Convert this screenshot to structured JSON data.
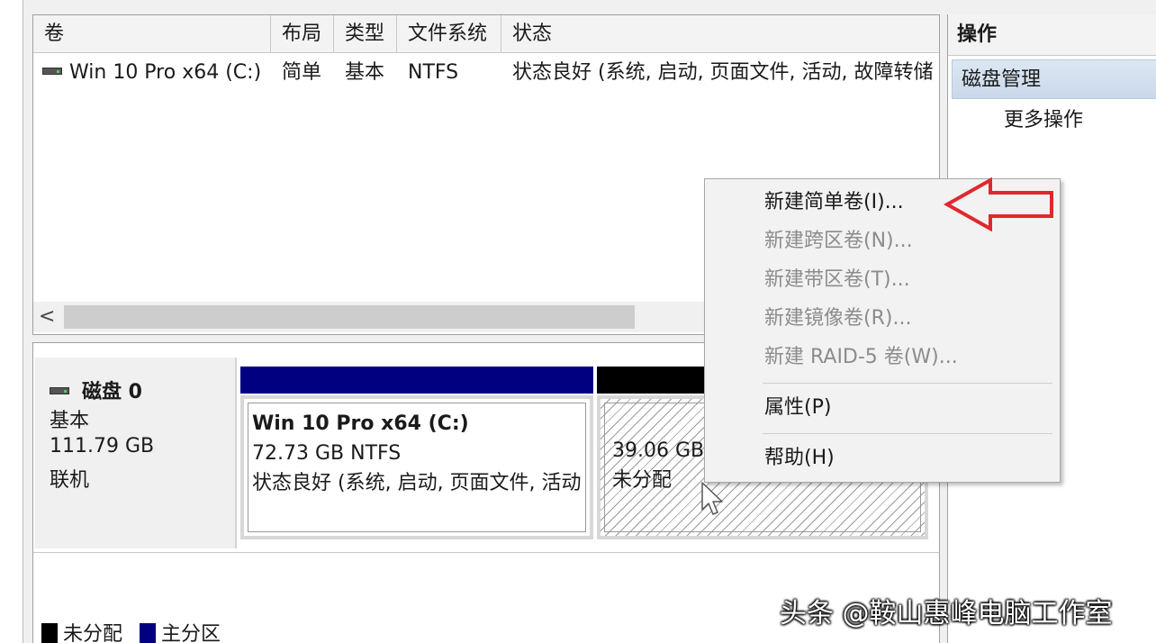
{
  "volume_list": {
    "columns": [
      "卷",
      "布局",
      "类型",
      "文件系统",
      "状态"
    ],
    "rows": [
      {
        "volume": "Win 10 Pro x64 (C:)",
        "layout": "简单",
        "type": "基本",
        "filesystem": "NTFS",
        "status": "状态良好 (系统, 启动, 页面文件, 活动, 故障转储"
      }
    ],
    "scroll_left_arrow": "<"
  },
  "disk": {
    "name": "磁盘 0",
    "kind": "基本",
    "size": "111.79 GB",
    "state": "联机",
    "partitions": [
      {
        "title": "Win 10 Pro x64  (C:)",
        "size_fs": "72.73 GB NTFS",
        "status": "状态良好 (系统, 启动, 页面文件, 活动",
        "bar_color": "#000080"
      },
      {
        "size": "39.06 GB",
        "label": "未分配",
        "bar_color": "#000000"
      }
    ]
  },
  "legend": {
    "items": [
      {
        "label": "未分配",
        "color": "#000000"
      },
      {
        "label": "主分区",
        "color": "#000080"
      }
    ]
  },
  "actions": {
    "header": "操作",
    "section": "磁盘管理",
    "more": "更多操作"
  },
  "context_menu": {
    "items": [
      {
        "label": "新建简单卷(I)...",
        "enabled": true
      },
      {
        "label": "新建跨区卷(N)...",
        "enabled": false
      },
      {
        "label": "新建带区卷(T)...",
        "enabled": false
      },
      {
        "label": "新建镜像卷(R)...",
        "enabled": false
      },
      {
        "label": "新建 RAID-5 卷(W)...",
        "enabled": false
      },
      {
        "label": "属性(P)",
        "enabled": true
      },
      {
        "label": "帮助(H)",
        "enabled": true
      }
    ]
  },
  "annotation": {
    "arrow_color": "#e0282c"
  },
  "watermark": "头条 @鞍山惠峰电脑工作室"
}
